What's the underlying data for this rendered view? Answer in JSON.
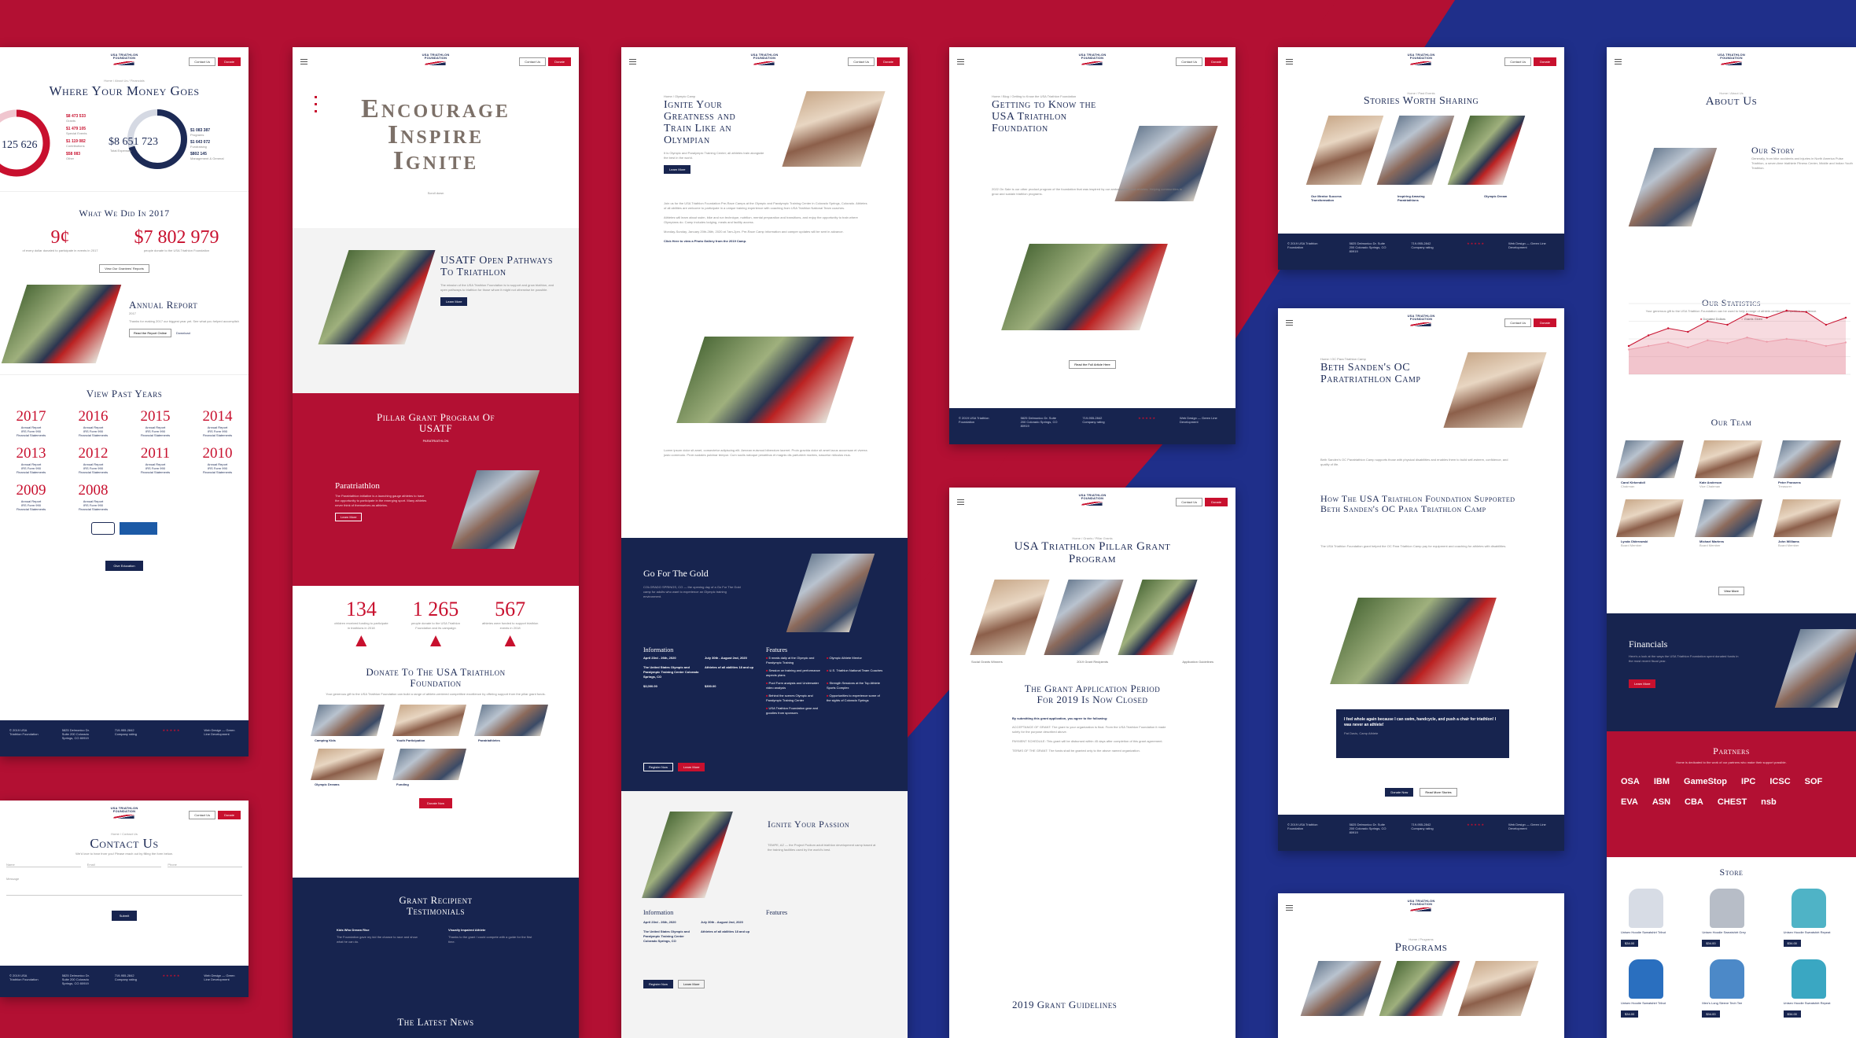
{
  "colors": {
    "crimson": "#b31033",
    "navy": "#17244f",
    "accent": "#c8102e"
  },
  "logo": {
    "line1": "USA TRIATHLON",
    "line2": "FOUNDATION"
  },
  "nav": {
    "contact": "Contact Us",
    "donate": "Donate"
  },
  "p1": {
    "title": "Where Your Money Goes",
    "crumb": "Home / About Us / Financials",
    "donut1": {
      "total": "125 626",
      "items": [
        {
          "amount": "$8 473 533",
          "label": "Grants"
        },
        {
          "amount": "$1 479 105",
          "label": "Special Events"
        },
        {
          "amount": "$1 119 082",
          "label": "Contributions"
        },
        {
          "amount": "$58 083",
          "label": "Other"
        }
      ]
    },
    "donut2": {
      "total": "$8 651 723",
      "label": "Total Expenses",
      "items": [
        {
          "amount": "$1 083 387",
          "label": "Programs"
        },
        {
          "amount": "$1 643 072",
          "label": "Fundraising"
        },
        {
          "amount": "$802 145",
          "label": "Management & General"
        }
      ]
    },
    "did_title": "What We Did In 2017",
    "stat1": {
      "value": "9¢",
      "label": "of every dollar donated to participate in events in 2017"
    },
    "stat2": {
      "value": "$7 802 979",
      "label": "people donate to the USA Triathlon Foundation"
    },
    "stat_btn": "View Our Grantees' Reports",
    "annual": {
      "title": "Annual Report",
      "year": "2017",
      "text": "Thanks for making 2017 our biggest year yet. See what you helped accomplish",
      "btn1": "Read the Report Online",
      "btn2": "Download"
    },
    "past_title": "View Past Years",
    "years": [
      {
        "year": "2017",
        "l1": "Annual Report",
        "l2": "IRS Form 990",
        "l3": "Financial Statements"
      },
      {
        "year": "2016",
        "l1": "Annual Report",
        "l2": "IRS Form 990",
        "l3": "Financial Statements"
      },
      {
        "year": "2015",
        "l1": "Annual Report",
        "l2": "IRS Form 990",
        "l3": "Financial Statements"
      },
      {
        "year": "2014",
        "l1": "Annual Report",
        "l2": "IRS Form 990",
        "l3": "Financial Statements"
      },
      {
        "year": "2013",
        "l1": "Annual Report",
        "l2": "IRS Form 990",
        "l3": "Financial Statements"
      },
      {
        "year": "2012",
        "l1": "Annual Report",
        "l2": "IRS Form 990",
        "l3": "Financial Statements"
      },
      {
        "year": "2011",
        "l1": "Annual Report",
        "l2": "IRS Form 990",
        "l3": "Financial Statements"
      },
      {
        "year": "2010",
        "l1": "Annual Report",
        "l2": "IRS Form 990",
        "l3": "Financial Statements"
      },
      {
        "year": "2009",
        "l1": "Annual Report",
        "l2": "IRS Form 990",
        "l3": "Financial Statements"
      },
      {
        "year": "2008",
        "l1": "Annual Report",
        "l2": "IRS Form 990",
        "l3": "Financial Statements"
      }
    ],
    "give_btn": "Give Education",
    "footer": {
      "c1": "© 2019 USA Triathlon Foundation",
      "c2": "5825 Delmonico Dr. Suite 200 Colorado Springs, CO 80919",
      "c3": "719-955-2842 Company rating",
      "c4": "Web Design — Green Line Development"
    }
  },
  "p1b": {
    "title": "Contact Us",
    "crumb": "Home / Contact Us",
    "intro": "We'd love to hear from you! Please reach out by filling the form below.",
    "f1": "Name",
    "f2": "Email",
    "f3": "Phone",
    "f4": "Message",
    "btn": "Submit"
  },
  "p2": {
    "hero1": "Encourage",
    "hero2": "Inspire",
    "hero3": "Ignite",
    "scroll": "Scroll down",
    "usatf_title": "USATF Open Pathways To Triathlon",
    "usatf_btn": "Learn More",
    "pillar_title": "Pillar Grant Program Of USATF",
    "pillar_sub": "PARATRIATHLON",
    "para_title": "Paratriathlon",
    "para_btn": "Learn More",
    "stats": [
      {
        "value": "134",
        "label": "children received funding to participate in triathlons in 2018"
      },
      {
        "value": "1 265",
        "label": "people donate to the USA Triathlon Foundation and its campaign"
      },
      {
        "value": "567",
        "label": "athletes were funded to support triathlon events in 2018"
      }
    ],
    "donate_title": "Donate To The USA Triathlon Foundation",
    "donate_text": "Your generous gift to the USA Triathlon Foundation can build a range of athlete-centered competitive excellence by offering support from the pillar grant funds.",
    "cats": [
      "Camping Kids",
      "Youth Participation",
      "Paratriathletes",
      "Olympic Dreams",
      "Funding"
    ],
    "donate_btn": "Donate Now",
    "testimonials": "Grant Recipient Testimonials",
    "t1": "Kids Who Dream Rise",
    "t2": "Visually Impaired Athlete",
    "news": "The Latest News"
  },
  "p3": {
    "crumb": "Home / Olympic Camp",
    "title": "Ignite Your Greatness and Train Like an Olympian",
    "btn": "Learn More",
    "link": "Click Here to view a Photo Gallery from the 2019 Camp.",
    "gold_title": "Go For The Gold",
    "info": "Information",
    "features": "Features",
    "i1": "April 23rd - 26th, 2020",
    "i2": "July 30th - August 2nd, 2020",
    "i3": "The United States Olympic and Paralympic Training Center Colorado Springs, CO",
    "i4": "Athletes of all abilities 18 and up",
    "i5": "$3,000.00",
    "i6": "$300.00",
    "f": [
      "5 meals daily at the Olympic and Paralympic Training",
      "Olympic Athlete Mentor",
      "Session on training and performance aspects plans",
      "U.S. Triathlon National Team Coaches",
      "Pool Form analysis and Underwater video analysis",
      "Strength Sessions at the Top Athlete Sports Complex",
      "Behind the scenes Olympic and Paralympic Training Center",
      "Opportunities to experience some of the sights of Colorado Springs",
      "USA Triathlon Foundation gear and goodies from sponsors"
    ],
    "register": "Register Now",
    "learn": "Learn More",
    "passion_title": "Ignite Your Passion"
  },
  "p4": {
    "crumb": "Home / Blog / Getting to Know the USA Triathlon Foundation",
    "title": "Getting to Know the USA Triathlon Foundation",
    "btn": "Read the Full Article Here",
    "footer": {
      "c1": "© 2019 USA Triathlon Foundation",
      "c2": "5825 Delmonico Dr. Suite 200 Colorado Springs, CO 80919",
      "c3": "719-955-2842 Company rating",
      "c4": "Web Design — Green Line Development"
    }
  },
  "p5": {
    "crumb": "Home / Grants / Pillar Grants",
    "title": "USA Triathlon Pillar Grant Program",
    "cap1": "Social Grants Winners",
    "cap2": "2019 Grant Recipients",
    "cap3": "Application Guidelines",
    "closed": "The Grant Application Period For 2019 Is Now Closed",
    "terms": "By submitting this grant application, you agree to the following:",
    "guidelines": "2019 Grant Guidelines"
  },
  "p6": {
    "crumb": "Home / Past Events",
    "title": "Stories Worth Sharing",
    "cap1": "Our Mentor Success Transformation",
    "cap2": "Inspiring Amazing Paratriathlons",
    "cap3": "Olympic Dream",
    "footer": {
      "c1": "© 2019 USA Triathlon Foundation",
      "c2": "5825 Delmonico Dr. Suite 200 Colorado Springs, CO 80919",
      "c3": "719-955-2842 Company rating",
      "c4": "Web Design — Green Line Development"
    }
  },
  "p7": {
    "crumb": "Home / OC Para Triathlon Camp",
    "title": "Beth Sanden's OC Paratriathlon Camp",
    "sub": "How The USA Triathlon Foundation Supported Beth Sanden's OC Para Triathlon Camp",
    "quote": "I feel whole again because I can swim, handcycle, and push a chair for triathlon! I was never an athlete!",
    "quote_by": "Pat Davis, Camp Athlete",
    "btn1": "Donate Now",
    "btn2": "Read More Stories",
    "footer": {
      "c1": "© 2019 USA Triathlon Foundation",
      "c2": "5825 Delmonico Dr. Suite 200 Colorado Springs, CO 80919",
      "c3": "719-955-2842 Company rating",
      "c4": "Web Design — Green Line Development"
    }
  },
  "p7b": {
    "crumb": "Home / Programs",
    "title": "Programs"
  },
  "p8": {
    "crumb": "Home / About Us",
    "title": "About Us",
    "story": "Our Story",
    "stats_title": "Our Statistics",
    "chart_legend1": "Donated Dollars",
    "chart_legend2": "Grants Given",
    "team_title": "Our Team",
    "team": [
      {
        "name": "Carol Kirkendoll",
        "role": "Chairman"
      },
      {
        "name": "Kate Anderson",
        "role": "Vice Chairman"
      },
      {
        "name": "Peter Fransens",
        "role": "Treasurer"
      },
      {
        "name": "Lynda Olderowski",
        "role": "Board Member"
      },
      {
        "name": "Michael Martens",
        "role": "Board Member"
      },
      {
        "name": "John Williams",
        "role": "Board Member"
      }
    ],
    "team_btn": "View More",
    "financials": "Financials",
    "fin_btn": "Learn More",
    "partners": "Partners",
    "partner_logos": [
      "OSA",
      "IBM",
      "GameStop",
      "IPC",
      "ICSC",
      "SOF",
      "EVA",
      "ASN",
      "CBA",
      "CHEST",
      "nsb"
    ],
    "store": "Store",
    "products": [
      {
        "name": "Unisex Hoodie Sweatshirt Tribut",
        "price": "$34.00"
      },
      {
        "name": "Unisex Hoodie Sweatshirt Grey",
        "price": "$34.00"
      },
      {
        "name": "Unisex Hoodie Sweatshirt Repeat",
        "price": "$34.00"
      },
      {
        "name": "Unisex Hoodie Sweatshirt Tribut",
        "price": "$34.00"
      },
      {
        "name": "Men's Long Sleeve Tech Tee",
        "price": "$34.00"
      },
      {
        "name": "Unisex Hoodie Sweatshirt Repeat",
        "price": "$34.00"
      }
    ]
  },
  "chart_data": {
    "type": "area",
    "title": "Our Statistics",
    "x": [
      "",
      "",
      "",
      "",
      "",
      "",
      "",
      "",
      "",
      "",
      "",
      ""
    ],
    "series": [
      {
        "name": "Donated Dollars",
        "values": [
          40,
          55,
          65,
          60,
          75,
          70,
          85,
          80,
          90,
          88,
          70,
          80
        ]
      },
      {
        "name": "Grants Given",
        "values": [
          35,
          40,
          45,
          38,
          48,
          44,
          52,
          46,
          50,
          47,
          40,
          45
        ]
      }
    ],
    "ylim": [
      0,
      100
    ],
    "grid": true,
    "legend": "top"
  }
}
